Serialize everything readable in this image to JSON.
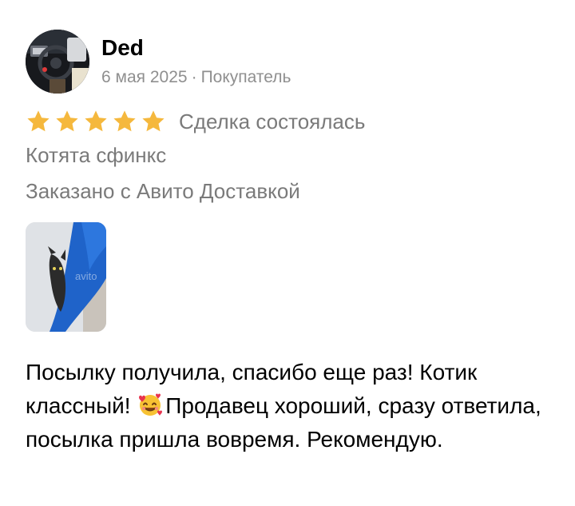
{
  "author": {
    "name": "Ded",
    "date": "6 мая 2025",
    "separator": "·",
    "role": "Покупатель"
  },
  "rating": {
    "stars": 5,
    "max_stars": 5,
    "star_color": "#f5b83d",
    "deal_status": "Сделка состоялась"
  },
  "item": {
    "title": "Котята сфинкс",
    "delivery": "Заказано с Авито Доставкой"
  },
  "photo": {
    "watermark": "avito"
  },
  "review": {
    "text_part1": "Посылку получила, спасибо еще раз! Котик классный!",
    "emoji": "smiling-face-with-hearts-icon",
    "text_part2": "Продавец хороший, сразу ответила, посылка пришла вовремя. Рекомендую."
  }
}
